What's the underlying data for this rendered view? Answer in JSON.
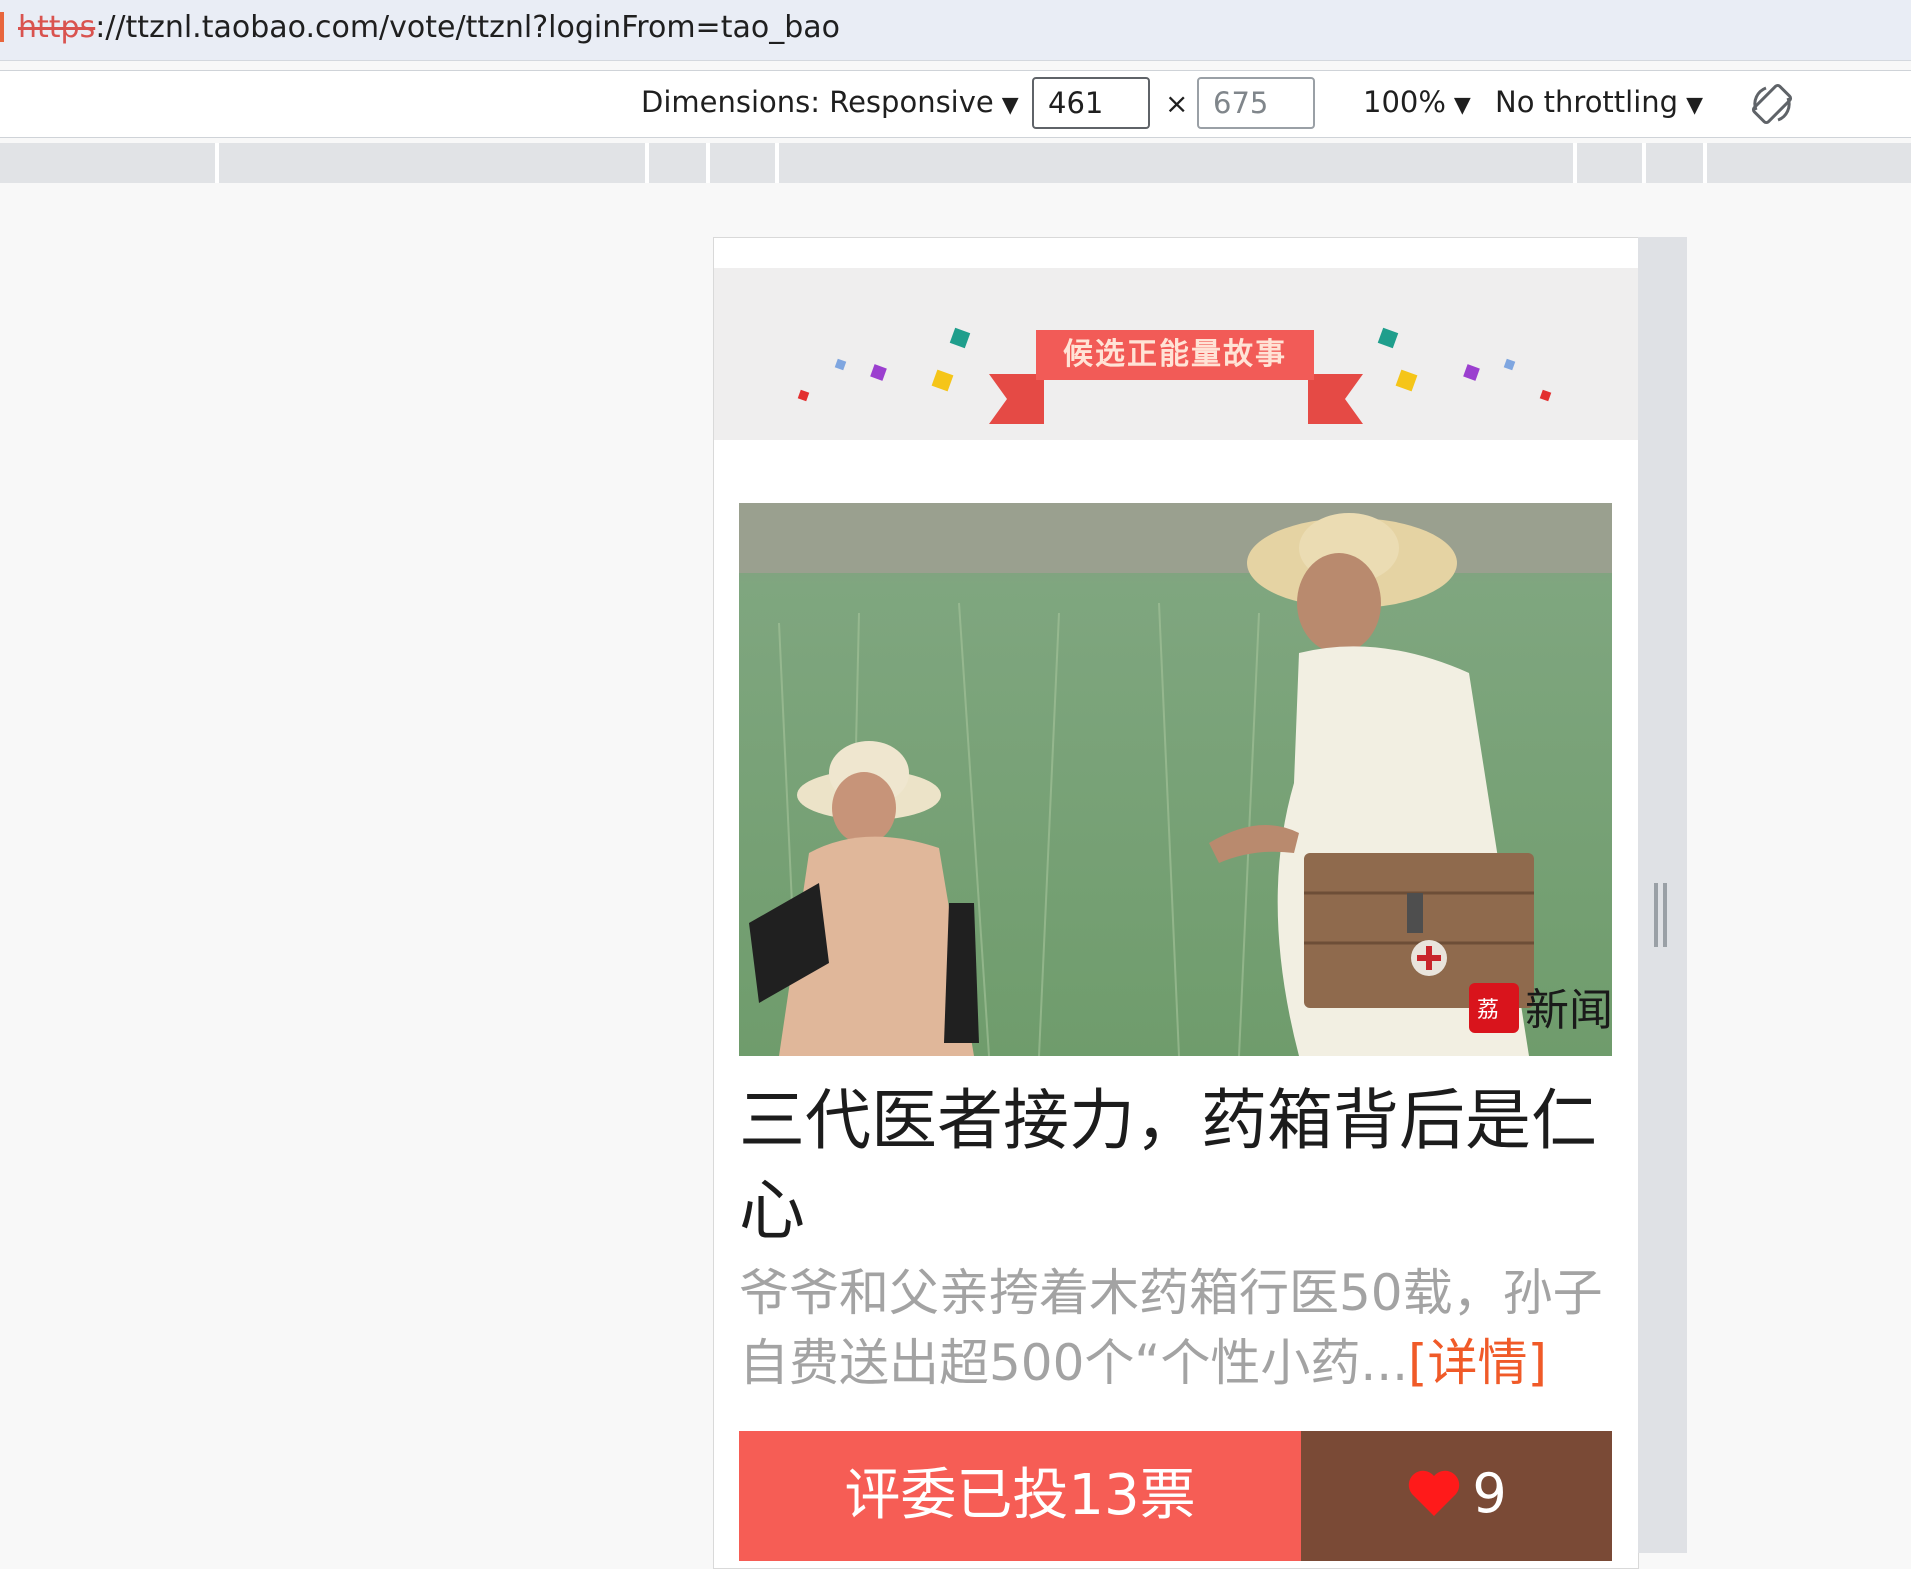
{
  "browser": {
    "url_protocol": "https",
    "url_rest": "://ttznl.taobao.com/vote/ttznl?loginFrom=tao_bao"
  },
  "device_toolbar": {
    "dimensions_label": "Dimensions: Responsive",
    "width_value": "461",
    "height_value": "675",
    "times": "×",
    "zoom": "100%",
    "throttling": "No throttling",
    "caret": "▼"
  },
  "page": {
    "banner_title": "候选正能量故事",
    "story_title": "三代医者接力，药箱背后是仁心",
    "story_desc": "爷爷和父亲挎着木药箱行医50载，孙子自费送出超500个“个性小药...",
    "more_link": "[详情]",
    "vote_button": "评委已投13票",
    "like_count": "9",
    "photo_watermark": "新闻",
    "colors": {
      "ribbon": "#f25b57",
      "vote": "#f65d55",
      "like": "#7a4a36",
      "link": "#f05a28"
    }
  }
}
